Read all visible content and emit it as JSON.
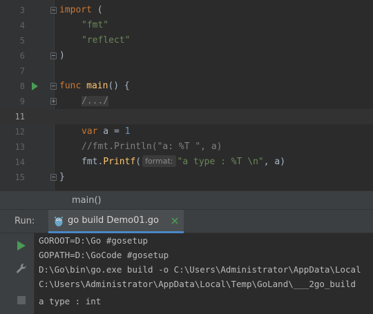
{
  "editor": {
    "lines": [
      {
        "num": "3"
      },
      {
        "num": "4"
      },
      {
        "num": "5"
      },
      {
        "num": "6"
      },
      {
        "num": "7"
      },
      {
        "num": "8"
      },
      {
        "num": "9"
      },
      {
        "num": "11"
      },
      {
        "num": "12"
      },
      {
        "num": "13"
      },
      {
        "num": "14"
      },
      {
        "num": "15"
      }
    ],
    "code": {
      "import_kw": "import",
      "import_open": " (",
      "import_fmt": "\"fmt\"",
      "import_reflect": "\"reflect\"",
      "import_close": ")",
      "func_kw": "func",
      "func_name": "main",
      "func_sig": "() {",
      "folded": "/.../",
      "var_kw": "var",
      "var_decl": " a = ",
      "var_value": "1",
      "comment": "//fmt.Println(\"a: %T \", a)",
      "printf_pkg": "fmt",
      "printf_dot": ".",
      "printf_name": "Printf",
      "printf_open": "(",
      "printf_hint": "format:",
      "printf_str": "\"a type : %T \\n\"",
      "printf_rest": ", a)",
      "close_brace": "}"
    }
  },
  "breadcrumb": {
    "label": "main()"
  },
  "run": {
    "label": "Run:",
    "tab_label": "go build Demo01.go",
    "console": [
      "GOROOT=D:\\Go #gosetup",
      "GOPATH=D:\\GoCode #gosetup",
      "D:\\Go\\bin\\go.exe build -o C:\\Users\\Administrator\\AppData\\Local",
      "C:\\Users\\Administrator\\AppData\\Local\\Temp\\GoLand\\___2go_build",
      "a type : int"
    ]
  },
  "colors": {
    "keyword": "#cc7832",
    "string": "#6a8759",
    "function": "#ffc66d",
    "comment": "#808080",
    "number": "#6897bb",
    "run_green": "#499c54",
    "current_line_number": "#a4a3a3"
  },
  "icons": [
    "run-gutter-icon",
    "fold-icon",
    "gopher-icon",
    "close-icon",
    "rerun-icon",
    "wrench-icon",
    "stop-icon"
  ]
}
